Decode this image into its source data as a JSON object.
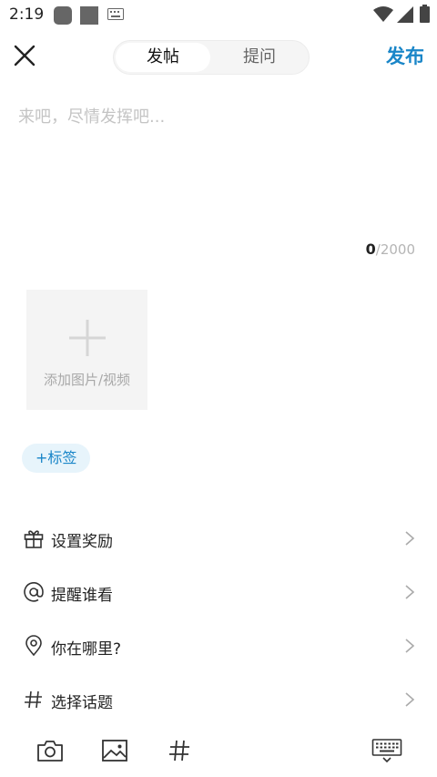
{
  "status_bar": {
    "time": "2:19"
  },
  "header": {
    "tabs": [
      {
        "label": "发帖",
        "active": true
      },
      {
        "label": "提问",
        "active": false
      }
    ],
    "publish_label": "发布"
  },
  "editor": {
    "placeholder": "来吧，尽情发挥吧...",
    "count_current": "0",
    "count_max": "/2000"
  },
  "media": {
    "add_label": "添加图片/视频"
  },
  "tag": {
    "label": "+标签"
  },
  "options": [
    {
      "icon": "gift-icon",
      "label": "设置奖励"
    },
    {
      "icon": "at-icon",
      "label": "提醒谁看"
    },
    {
      "icon": "location-pin-icon",
      "label": "你在哪里?"
    },
    {
      "icon": "hashtag-icon",
      "label": "选择话题"
    }
  ],
  "bottom_bar": [
    "camera-icon",
    "image-icon",
    "hashtag-icon",
    "keyboard-icon"
  ],
  "colors": {
    "accent": "#1a86c8",
    "tag_bg": "#e7f4fb",
    "placeholder": "#c4c4c4"
  }
}
